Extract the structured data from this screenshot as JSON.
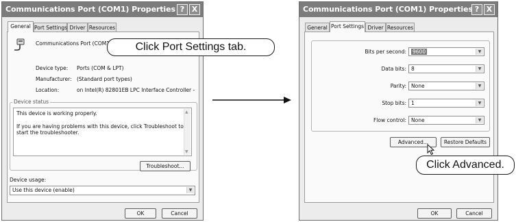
{
  "left_dialog": {
    "title": "Communications Port (COM1) Properties",
    "help_button": "?",
    "close_button": "X",
    "tabs": [
      {
        "label": "General",
        "active": true
      },
      {
        "label": "Port Settings",
        "active": false
      },
      {
        "label": "Driver",
        "active": false
      },
      {
        "label": "Resources",
        "active": false
      }
    ],
    "device_name": "Communications Port (COM1)",
    "properties": [
      {
        "label": "Device type:",
        "value": "Ports (COM & LPT)"
      },
      {
        "label": "Manufacturer:",
        "value": "(Standard port types)"
      },
      {
        "label": "Location:",
        "value": "on Intel(R) 82801EB LPC Interface Controller -"
      }
    ],
    "device_status_label": "Device status",
    "status_line1": "This device is working properly.",
    "status_line2": "If you are having problems with this device, click Troubleshoot to",
    "status_line3": "start the troubleshooter.",
    "troubleshoot_button": "Troubleshoot...",
    "device_usage_label": "Device usage:",
    "device_usage_value": "Use this device (enable)",
    "ok_button": "OK",
    "cancel_button": "Cancel",
    "callout": "Click Port Settings tab."
  },
  "right_dialog": {
    "title": "Communications Port (COM1) Properties",
    "help_button": "?",
    "close_button": "X",
    "tabs": [
      {
        "label": "General",
        "active": false
      },
      {
        "label": "Port Settings",
        "active": true
      },
      {
        "label": "Driver",
        "active": false
      },
      {
        "label": "Resources",
        "active": false
      }
    ],
    "settings": [
      {
        "label": "Bits per second:",
        "value": "9600",
        "selected": true
      },
      {
        "label": "Data bits:",
        "value": "8",
        "selected": false
      },
      {
        "label": "Parity:",
        "value": "None",
        "selected": false
      },
      {
        "label": "Stop bits:",
        "value": "1",
        "selected": false
      },
      {
        "label": "Flow control:",
        "value": "None",
        "selected": false
      }
    ],
    "advanced_button": "Advanced...",
    "restore_button": "Restore Defaults",
    "ok_button": "OK",
    "cancel_button": "Cancel",
    "callout": "Click Advanced."
  },
  "icons": {
    "help": "help-icon",
    "close": "close-icon",
    "port": "serial-port-icon",
    "dropdown": "chevron-down-icon",
    "cursor": "mouse-cursor-icon",
    "arrow": "arrow-right-icon"
  },
  "colors": {
    "titlebar": "#7c7c7c",
    "dialog_bg": "#ececec",
    "panel_bg": "#fafafa",
    "selection": "#777777"
  }
}
